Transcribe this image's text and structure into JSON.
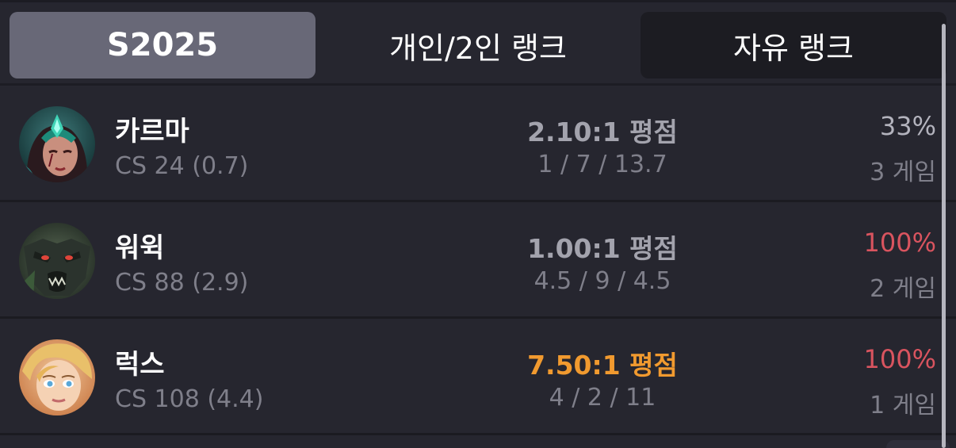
{
  "tabs": {
    "season": "S2025",
    "solo": "개인/2인 랭크",
    "flex": "자유 랭크"
  },
  "colors": {
    "background": "#26262f",
    "active_tab": "#686877",
    "kda_high": "#f19a2f",
    "winrate_perfect": "#d9545f"
  },
  "champions": [
    {
      "name": "카르마",
      "cs": "CS 24 (0.7)",
      "kda_ratio": "2.10:1 평점",
      "kda": "1 / 7 / 13.7",
      "winrate": "33%",
      "games": "3 게임",
      "avatar_icon": "karma-portrait-icon"
    },
    {
      "name": "워윅",
      "cs": "CS 88 (2.9)",
      "kda_ratio": "1.00:1 평점",
      "kda": "4.5 / 9 / 4.5",
      "winrate": "100%",
      "games": "2 게임",
      "avatar_icon": "warwick-portrait-icon"
    },
    {
      "name": "럭스",
      "cs": "CS 108 (4.4)",
      "kda_ratio": "7.50:1 평점",
      "kda": "4 / 2 / 11",
      "winrate": "100%",
      "games": "1 게임",
      "avatar_icon": "lux-portrait-icon"
    }
  ]
}
